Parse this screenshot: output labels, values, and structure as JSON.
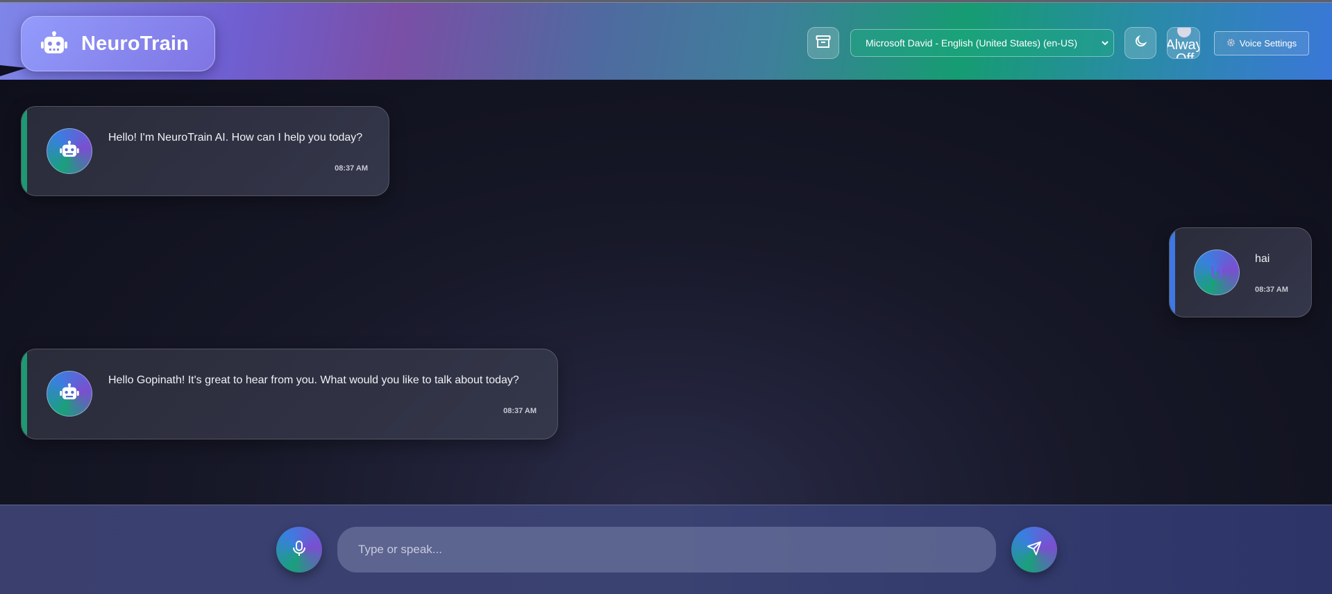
{
  "app": {
    "title": "NeuroTrain"
  },
  "header": {
    "voice_select_value": "Microsoft David - English (United States) (en-US)",
    "always_toggle_label": "Alway",
    "always_toggle_state": "Off",
    "voice_settings_label": "Voice Settings"
  },
  "messages": [
    {
      "role": "bot",
      "text": "Hello! I'm NeuroTrain AI. How can I help you today?",
      "time": "08:37 AM"
    },
    {
      "role": "user",
      "avatar_letter": "U",
      "text": "hai",
      "time": "08:37 AM"
    },
    {
      "role": "bot",
      "text": "Hello Gopinath! It's great to hear from you. What would you like to talk about today?",
      "time": "08:37 AM"
    }
  ],
  "composer": {
    "placeholder": "Type or speak..."
  },
  "icons": {
    "brand": "robot-icon",
    "archive": "archive-icon",
    "theme": "moon-icon",
    "settings": "gear-icon",
    "mic": "microphone-icon",
    "send": "send-icon"
  },
  "colors": {
    "bot_accent": "#1e9a73",
    "user_accent": "#3f78e0",
    "background": "#11131f"
  }
}
